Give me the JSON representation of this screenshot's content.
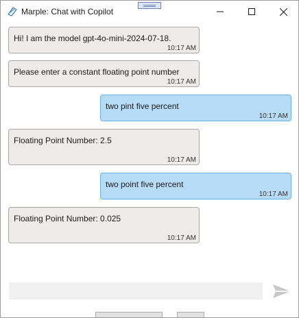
{
  "window": {
    "title": "Marple: Chat with Copilot",
    "controls": {
      "minimize": "minimize",
      "maximize": "maximize",
      "close": "close"
    }
  },
  "messages": [
    {
      "sender": "bot",
      "text": "Hi! I am the model gpt-4o-mini-2024-07-18.",
      "time": "10:17 AM"
    },
    {
      "sender": "bot",
      "text": "Please enter a constant floating point number",
      "time": "10:17 AM"
    },
    {
      "sender": "user",
      "text": "two pint five percent",
      "time": "10:17 AM"
    },
    {
      "sender": "bot",
      "text": "Floating Point Number: 2.5",
      "time": "10:17 AM"
    },
    {
      "sender": "user",
      "text": "two point five percent",
      "time": "10:17 AM"
    },
    {
      "sender": "bot",
      "text": "Floating Point Number: 0.025",
      "time": "10:17 AM"
    }
  ],
  "composer": {
    "value": "",
    "placeholder": ""
  },
  "icons": {
    "app": "copilot-icon",
    "send": "send-icon"
  },
  "colors": {
    "bot_bubble": "#efebe8",
    "bot_border": "#a9a6a3",
    "user_bubble": "#b7dcf8",
    "user_border": "#6aaee6",
    "input_bg": "#f0f0f0",
    "send_icon": "#c8c8c8"
  }
}
